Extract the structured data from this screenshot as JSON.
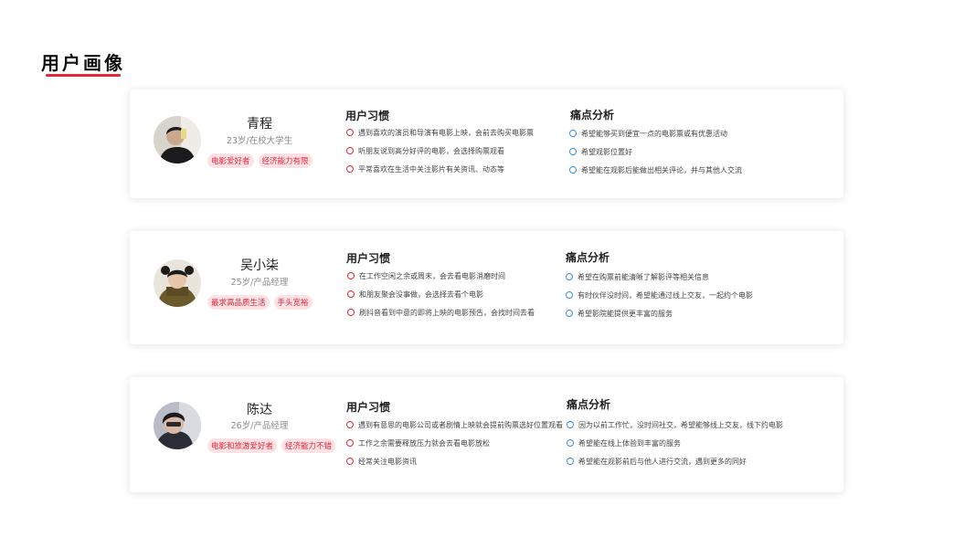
{
  "page": {
    "title": "用户画像"
  },
  "personas": [
    {
      "name": "青程",
      "subtitle": "23岁/在校大学生",
      "tags": [
        "电影爱好者",
        "经济能力有限"
      ],
      "habits_title": "用户习惯",
      "habits": [
        "遇到喜欢的演员和导演有电影上映，会前去购买电影票",
        "听朋友说到高分好评的电影，会选择购票观看",
        "平常喜欢在生活中关注影片有关资讯、动态等"
      ],
      "pains_title": "痛点分析",
      "pains": [
        "希望能够买到便宜一点的电影票或有优惠活动",
        "希望观影位置好",
        "希望能在观影后能做出相关评论，并与其他人交流"
      ]
    },
    {
      "name": "吴小柒",
      "subtitle": "25岁/产品经理",
      "tags": [
        "最求高品质生活",
        "手头宽裕"
      ],
      "habits_title": "用户习惯",
      "habits": [
        "在工作空闲之余或周末，会去看电影消磨时间",
        "和朋友聚会没事做，会选择去看个电影",
        "刷抖音看到中意的即将上映的电影预告，会找时间去看"
      ],
      "pains_title": "痛点分析",
      "pains": [
        "希望在购票前能清晰了解影评等相关信息",
        "有时伙伴没时间，希望能通过线上交友，一起约个电影",
        "希望影院能提供更丰富的服务"
      ]
    },
    {
      "name": "陈达",
      "subtitle": "26岁/产品经理",
      "tags": [
        "电影和旅游爱好者",
        "经济能力不错"
      ],
      "habits_title": "用户习惯",
      "habits": [
        "遇到有意思的电影公司或者剧情上映就会提前购票选好位置观看",
        "工作之余需要释放压力就会去看电影放松",
        "经常关注电影资讯"
      ],
      "pains_title": "痛点分析",
      "pains": [
        "因为以前工作忙，没时间社交，希望能够线上交友，线下约电影",
        "希望能在线上体验到丰富的服务",
        "希望能在观影前后与他人进行交流，遇到更多的同好"
      ]
    }
  ],
  "colors": {
    "accent": "#e0283a",
    "tag_bg": "#fde1e4",
    "pain_dot": "#3a8ee6"
  },
  "icons": {
    "habit_bullet": "red-ring-icon",
    "pain_bullet": "blue-ring-icon"
  }
}
